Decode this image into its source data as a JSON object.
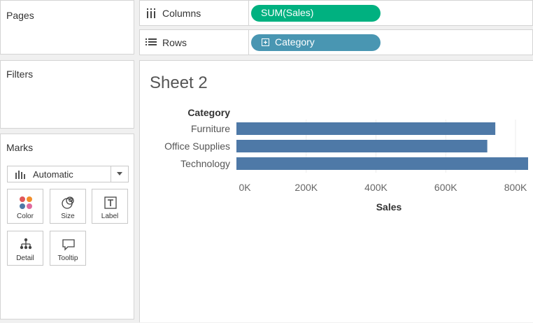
{
  "left_panel": {
    "pages_title": "Pages",
    "filters_title": "Filters",
    "marks": {
      "title": "Marks",
      "mark_type": "Automatic",
      "buttons": {
        "color": "Color",
        "size": "Size",
        "label": "Label",
        "detail": "Detail",
        "tooltip": "Tooltip"
      }
    }
  },
  "shelves": {
    "columns": {
      "label": "Columns",
      "pill": "SUM(Sales)",
      "pill_color": "#00b180"
    },
    "rows": {
      "label": "Rows",
      "pill": "Category",
      "pill_color": "#4996b2"
    }
  },
  "sheet": {
    "title": "Sheet 2"
  },
  "chart_data": {
    "type": "bar",
    "orientation": "horizontal",
    "row_header": "Category",
    "categories": [
      "Furniture",
      "Office Supplies",
      "Technology"
    ],
    "values": [
      742000,
      719000,
      836000
    ],
    "xlabel": "Sales",
    "x_ticks": [
      "0K",
      "200K",
      "400K",
      "600K",
      "800K"
    ],
    "x_tick_values": [
      0,
      200000,
      400000,
      600000,
      800000
    ],
    "xlim": [
      0,
      836000
    ],
    "bar_color": "#4e79a7",
    "grid": true
  }
}
